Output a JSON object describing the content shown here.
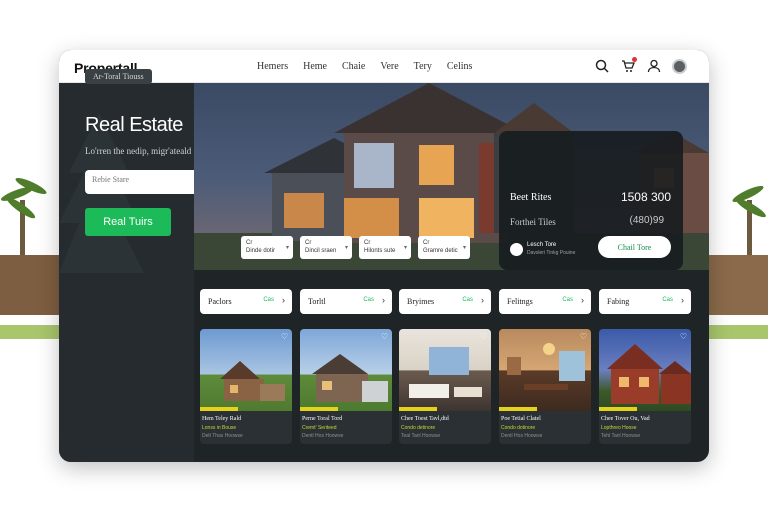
{
  "app": {
    "logo": "Propertall"
  },
  "nav": {
    "items": [
      "Hemers",
      "Heme",
      "Chaie",
      "Vere",
      "Tery",
      "Celins"
    ]
  },
  "top_icons": [
    "search-icon",
    "cart-icon",
    "user-icon",
    "avatar"
  ],
  "hero": {
    "pill": "Ar-Toral Tiouss",
    "title": "Real Estate",
    "subtitle": "Lo'rren the nedip, migr'ateald",
    "search_placeholder": "Rebie Stare",
    "cta": "Real Tuirs",
    "filters": [
      {
        "line1": "Cr",
        "line2": "Dinde dotir"
      },
      {
        "line1": "Cr",
        "line2": "Dincil sraen"
      },
      {
        "line1": "Cr",
        "line2": "Hilonts sute"
      },
      {
        "line1": "Cr",
        "line2": "Gramre detic"
      }
    ]
  },
  "stat_card": {
    "label1": "Beet Rites",
    "value1": "1508 300",
    "label2": "Forthei Tiles",
    "value2": "(480)99",
    "agent_name": "Lesch Tore",
    "agent_sub": "Davsleri Tinkg Pouine",
    "button": "Chail Tore"
  },
  "categories": [
    {
      "label": "Paclors",
      "sub": "Cas"
    },
    {
      "label": "Torltl",
      "sub": "Cas"
    },
    {
      "label": "Bryimes",
      "sub": "Cas"
    },
    {
      "label": "Felitngs",
      "sub": "Cas"
    },
    {
      "label": "Fabing",
      "sub": "Cas"
    }
  ],
  "listings": [
    {
      "title": "Hem Teley Rald",
      "price": "Lonss in Bouse",
      "meta": "Delt Thas Hoowse"
    },
    {
      "title": "Perne Toral Tord",
      "price": "Cremt' Seriteed",
      "meta": "Dentl Hos Hoowse"
    },
    {
      "title": "Chee Toest Tavl,dtd",
      "price": "Condo detinore",
      "meta": "Teal Tanl Hoowse"
    },
    {
      "title": "Poe Tetial Clatel",
      "price": "Condo dotinore",
      "meta": "Dentl Hos Hoowse"
    },
    {
      "title": "Chee Tover Ou, Vad",
      "price": "Lopthreo Hoose",
      "meta": "Tehl Tanl Hoowse"
    }
  ],
  "colors": {
    "accent": "#1dba5a",
    "panel": "#252b2e",
    "window": "#1f2427",
    "highlight": "#e5d31a"
  }
}
